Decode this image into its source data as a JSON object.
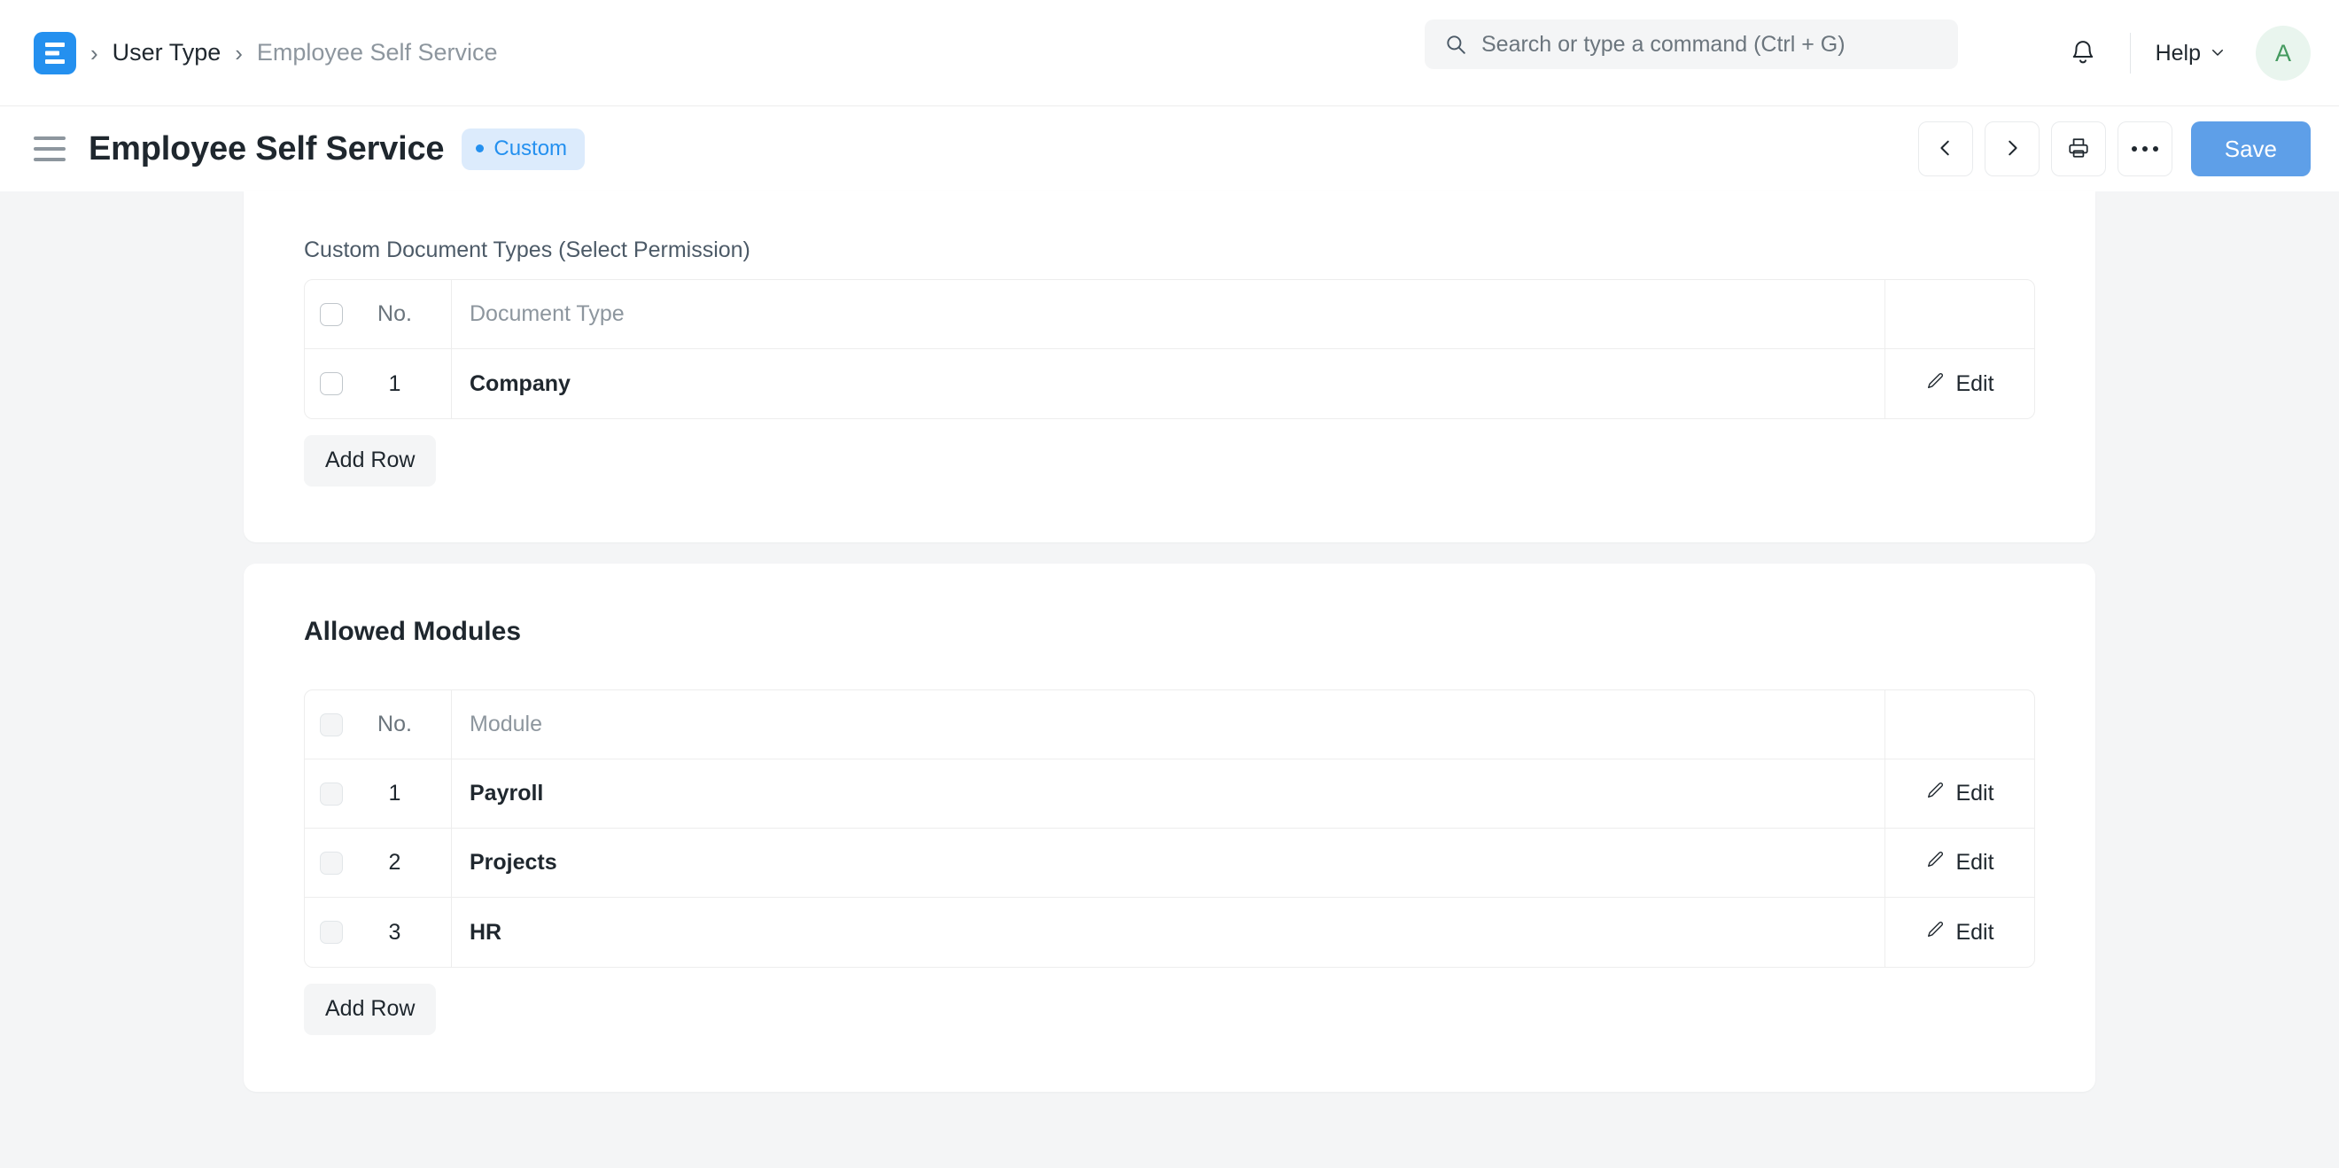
{
  "navbar": {
    "logo_icon": "erpnext-logo-icon",
    "breadcrumb": {
      "separator": "›",
      "parent_label": "User Type",
      "current_label": "Employee Self Service"
    },
    "search": {
      "icon": "search-icon",
      "placeholder": "Search or type a command (Ctrl + G)",
      "value": ""
    },
    "notifications_icon": "bell-icon",
    "help_label": "Help",
    "help_chevron_icon": "chevron-down-icon",
    "avatar_initial": "A"
  },
  "page_head": {
    "menu_icon": "hamburger-icon",
    "title": "Employee Self Service",
    "badge": {
      "label": "Custom",
      "dot_color": "#2490EF",
      "bg_color": "#DCEBFC",
      "text_color": "#2490EF"
    },
    "actions": {
      "prev_icon": "chevron-left-icon",
      "next_icon": "chevron-right-icon",
      "print_icon": "printer-icon",
      "more_icon": "ellipsis-icon",
      "save_label": "Save",
      "save_color": "#5E9FE8"
    }
  },
  "sections": [
    {
      "id": "custom-document-types",
      "label": "Custom Document Types (Select Permission)",
      "is_section_heading": false,
      "table": {
        "columns": {
          "no": "No.",
          "main": "Document Type",
          "edit": ""
        },
        "rows": [
          {
            "no": "1",
            "main": "Company",
            "edit_label": "Edit",
            "edit_icon": "pencil-icon"
          }
        ]
      },
      "add_row_label": "Add Row"
    },
    {
      "id": "allowed-modules",
      "label": "Allowed Modules",
      "is_section_heading": true,
      "table": {
        "columns": {
          "no": "No.",
          "main": "Module",
          "edit": ""
        },
        "rows": [
          {
            "no": "1",
            "main": "Payroll",
            "edit_label": "Edit",
            "edit_icon": "pencil-icon"
          },
          {
            "no": "2",
            "main": "Projects",
            "edit_label": "Edit",
            "edit_icon": "pencil-icon"
          },
          {
            "no": "3",
            "main": "HR",
            "edit_label": "Edit",
            "edit_icon": "pencil-icon"
          }
        ]
      },
      "add_row_label": "Add Row"
    }
  ]
}
